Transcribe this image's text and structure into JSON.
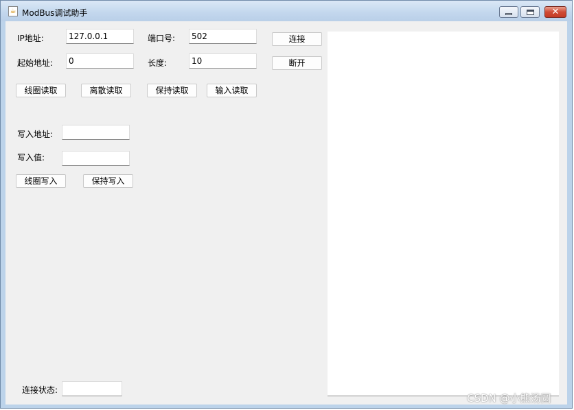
{
  "window": {
    "title": "ModBus调试助手",
    "icon": "java-cup-icon"
  },
  "connection": {
    "ip_label": "IP地址:",
    "ip_value": "127.0.0.1",
    "port_label": "端口号:",
    "port_value": "502",
    "start_label": "起始地址:",
    "start_value": "0",
    "length_label": "长度:",
    "length_value": "10",
    "connect_label": "连接",
    "disconnect_label": "断开"
  },
  "read_buttons": {
    "coil_read": "线圈读取",
    "discrete_read": "离散读取",
    "holding_read": "保持读取",
    "input_read": "输入读取"
  },
  "write": {
    "address_label": "写入地址:",
    "address_value": "",
    "value_label": "写入值:",
    "value_value": "",
    "coil_write": "线圈写入",
    "holding_write": "保持写入"
  },
  "status": {
    "label": "连接状态:",
    "value": ""
  },
  "log": {
    "content": ""
  },
  "watermark": "CSDN @小熊汤圆"
}
